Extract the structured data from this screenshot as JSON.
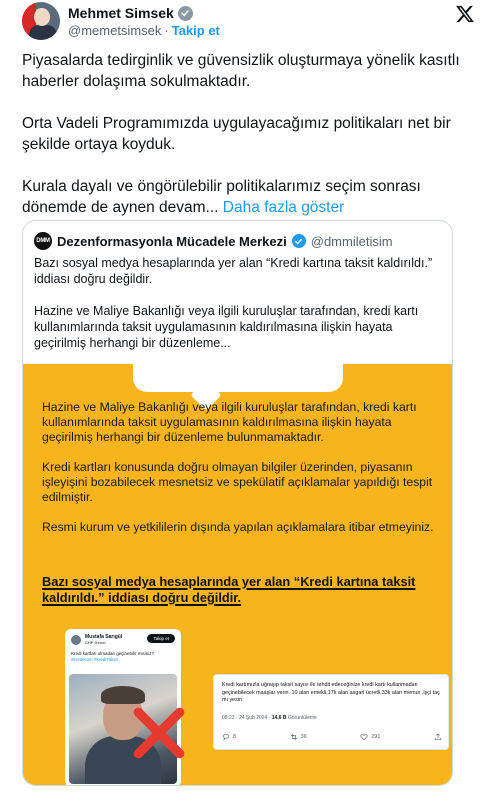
{
  "author": {
    "name": "Mehmet Simsek",
    "handle": "@memetsimsek",
    "separator": "·",
    "follow_label": "Takip et"
  },
  "tweet": {
    "paragraphs": [
      "Piyasalarda tedirginlik ve güvensizlik oluşturmaya yönelik kasıtlı haberler dolaşıma sokulmaktadır.",
      "Orta Vadeli Programımızda uygulayacağımız politikaları net bir şekilde ortaya koyduk.",
      "Kurala dayalı ve öngörülebilir politikalarımız seçim sonrası dönemde de aynen devam..."
    ],
    "show_more": "Daha fazla göster"
  },
  "quote": {
    "avatar_text": "DMM",
    "name": "Dezenformasyonla Mücadele Merkezi",
    "handle": "@dmmiletisim",
    "paragraphs": [
      "Bazı sosyal medya hesaplarında yer alan “Kredi kartına taksit kaldırıldı.” iddiası doğru değildir.",
      "Hazine ve Maliye Bakanlığı veya ilgili kuruluşlar tarafından, kredi kartı kullanımlarında taksit uygulamasının kaldırılmasına ilişkin hayata geçirilmiş herhangi bir düzenleme..."
    ]
  },
  "infographic": {
    "paragraphs": [
      "Hazine ve Maliye Bakanlığı veya ilgili kuruluşlar tarafından, kredi kartı kullanımlarında taksit uygulamasının kaldırılmasına ilişkin hayata geçirilmiş herhangi bir düzenleme bulunmamaktadır.",
      "Kredi kartları konusunda doğru olmayan bilgiler üzerinden, piyasanın işleyişini bozabilecek mesnetsiz ve spekülatif açıklamalar yapıldığı tespit edilmiştir.",
      "Resmi kurum ve yetkililerin dışında yapılan açıklamalara itibar etmeyiniz."
    ],
    "bold_claim": "Bazı sosyal medya hesaplarında yer alan “Kredi kartına taksit kaldırıldı.” iddiası doğru değildir.",
    "embedded_tweet_left": {
      "name": "Mustafa Sarıgül",
      "sub": "CHP Genel",
      "follow": "Takip et",
      "text": "Kredi kartları olmadan geçinebilir misiniz?",
      "tags": "#krediKartı #krediTaksit"
    },
    "embedded_tweet_right": {
      "text": "Kredi kartımızla uğraşıp taksit sayısı ile tehdit edeceğinize kredi kartı kullanmadan geçinebilecek maaşlar verin. 10 alan emekli,17k alan asgari ücretli,33k alan memur ,işçi taç mı yesin",
      "time": "08:23 · 24 Şub 2024 ·",
      "views_count": "14,6 B",
      "views_label": "Görüntüleme",
      "replies": "8",
      "retweets": "36",
      "likes": "291"
    }
  },
  "colors": {
    "accent": "#1d9bf0",
    "infographic_bg": "#f7b41c",
    "cross": "#e63a2e"
  }
}
